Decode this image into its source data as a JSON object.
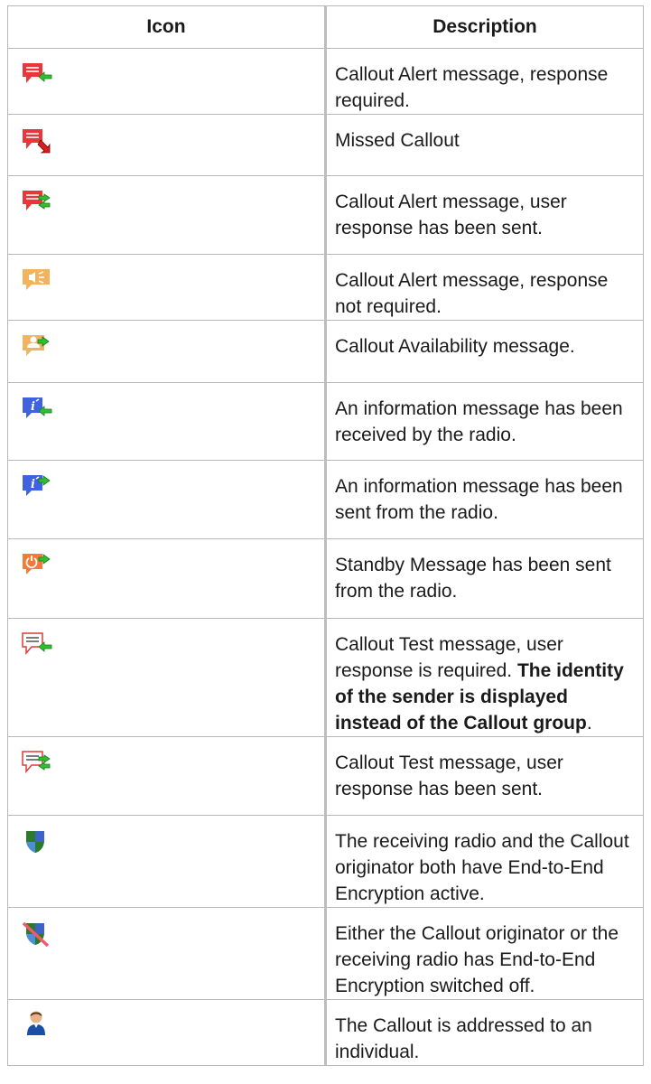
{
  "headers": {
    "icon": "Icon",
    "description": "Description"
  },
  "rows": [
    {
      "icon": "red-callout-received-icon",
      "text": "Callout Alert message, response required."
    },
    {
      "icon": "red-missed-callout-icon",
      "text": "Missed Callout"
    },
    {
      "icon": "red-callout-responded-icon",
      "text": "Callout Alert message, user response has been sent."
    },
    {
      "icon": "orange-callout-no-response-icon",
      "text": "Callout Alert message, response not required."
    },
    {
      "icon": "orange-availability-icon",
      "text": "Callout Availability message."
    },
    {
      "icon": "blue-info-received-icon",
      "text": "An information message has been received by the radio."
    },
    {
      "icon": "blue-info-sent-icon",
      "text": "An information message has been sent from the radio."
    },
    {
      "icon": "orange-standby-sent-icon",
      "text": "Standby Message has been sent from the radio."
    },
    {
      "icon": "test-callout-received-icon",
      "text": "Callout Test message, user response is required. ",
      "bold": "The identity of the sender is displayed instead of the Callout group",
      "after": "."
    },
    {
      "icon": "test-callout-responded-icon",
      "text": "Callout Test message, user response has been sent."
    },
    {
      "icon": "encryption-shield-icon",
      "text": "The receiving radio and the Callout originator both have End-to-End Encryption active."
    },
    {
      "icon": "encryption-off-shield-icon",
      "text": "Either the Callout originator or the receiving radio has End-to-End Encryption switched off."
    },
    {
      "icon": "individual-person-icon",
      "text": "The Callout is addressed to an individual."
    }
  ]
}
